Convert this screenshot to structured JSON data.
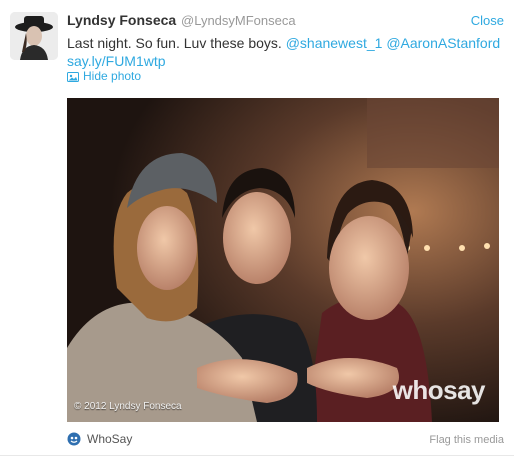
{
  "tweet": {
    "author_name": "Lyndsy Fonseca",
    "author_handle": "@LyndsyMFonseca",
    "close_label": "Close",
    "text_prefix": "Last night. So fun. Luv these boys. ",
    "mention_1": "@shanewest_1",
    "mention_2": "@AaronAStanford",
    "link": "say.ly/FUM1wtp",
    "hide_photo_label": "Hide photo"
  },
  "media": {
    "copyright": "© 2012 Lyndsy Fonseca",
    "watermark": "whosay",
    "source_label": "WhoSay",
    "flag_label": "Flag this media"
  },
  "colors": {
    "link": "#2fa9e0",
    "text": "#333333",
    "muted": "#999999"
  },
  "icons": [
    "photo-icon",
    "whosay-icon"
  ]
}
